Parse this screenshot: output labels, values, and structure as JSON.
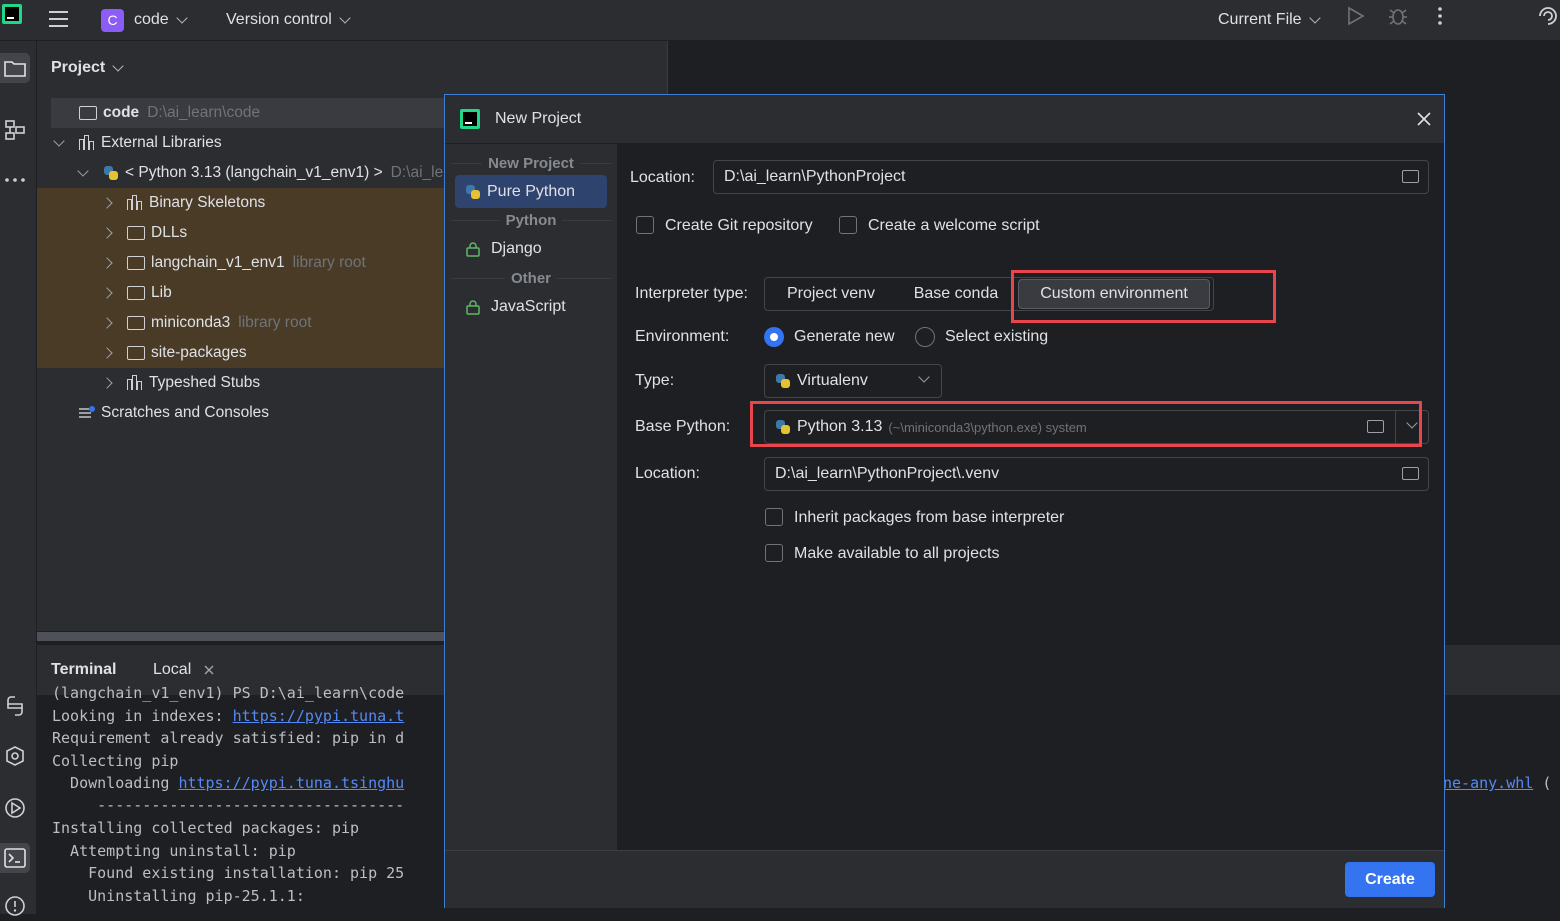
{
  "topbar": {
    "project_badge": "C",
    "project_name": "code",
    "vcs": "Version control",
    "run_config": "Current File"
  },
  "project_panel": {
    "title": "Project",
    "tree": [
      {
        "label": "code",
        "hint": "D:\\ai_learn\\code"
      },
      {
        "label": "External Libraries",
        "hint": ""
      },
      {
        "label": "< Python 3.13 (langchain_v1_env1) >",
        "hint": "D:\\ai_le"
      },
      {
        "label": "Binary Skeletons",
        "hint": ""
      },
      {
        "label": "DLLs",
        "hint": ""
      },
      {
        "label": "langchain_v1_env1",
        "hint": "library root"
      },
      {
        "label": "Lib",
        "hint": ""
      },
      {
        "label": "miniconda3",
        "hint": "library root"
      },
      {
        "label": "site-packages",
        "hint": ""
      },
      {
        "label": "Typeshed Stubs",
        "hint": ""
      },
      {
        "label": "Scratches and Consoles",
        "hint": ""
      }
    ]
  },
  "terminal": {
    "tab_title": "Terminal",
    "tab_local": "Local",
    "lines": [
      "(langchain_v1_env1) PS D:\\ai_learn\\code",
      "Looking in indexes: ",
      "Requirement already satisfied: pip in d",
      "Collecting pip",
      "  Downloading ",
      "     ----------------------------------",
      "Installing collected packages: pip",
      "  Attempting uninstall: pip",
      "    Found existing installation: pip 25",
      "    Uninstalling pip-25.1.1:"
    ],
    "link_index": "https://pypi.tuna.t",
    "link_download": "https://pypi.tuna.tsinghu",
    "link_whl": "ne-any.whl",
    "trailing_paren": "("
  },
  "dialog": {
    "title": "New Project",
    "side_groups": {
      "new_project": "New Project",
      "python": "Python",
      "other": "Other"
    },
    "side_items": {
      "pure_python": "Pure Python",
      "django": "Django",
      "javascript": "JavaScript"
    },
    "location_label": "Location:",
    "location_value": "D:\\ai_learn\\PythonProject",
    "create_git": "Create Git repository",
    "create_welcome": "Create a welcome script",
    "interpreter_type_label": "Interpreter type:",
    "interpreter_types": [
      "Project venv",
      "Base conda",
      "Custom environment"
    ],
    "interpreter_type_selected": "Custom environment",
    "environment_label": "Environment:",
    "env_generate": "Generate new",
    "env_select": "Select existing",
    "type_label": "Type:",
    "type_value": "Virtualenv",
    "base_python_label": "Base Python:",
    "base_python_value": "Python 3.13",
    "base_python_hint": "(~\\miniconda3\\python.exe) system",
    "venv_location_label": "Location:",
    "venv_location_value": "D:\\ai_learn\\PythonProject\\.venv",
    "inherit_packages": "Inherit packages from base interpreter",
    "make_available": "Make available to all projects",
    "create_button": "Create"
  },
  "colors": {
    "accent": "#3574f0",
    "highlight_box": "#e8464c",
    "selection": "#2e436e",
    "badge": "#8c5cf6"
  }
}
